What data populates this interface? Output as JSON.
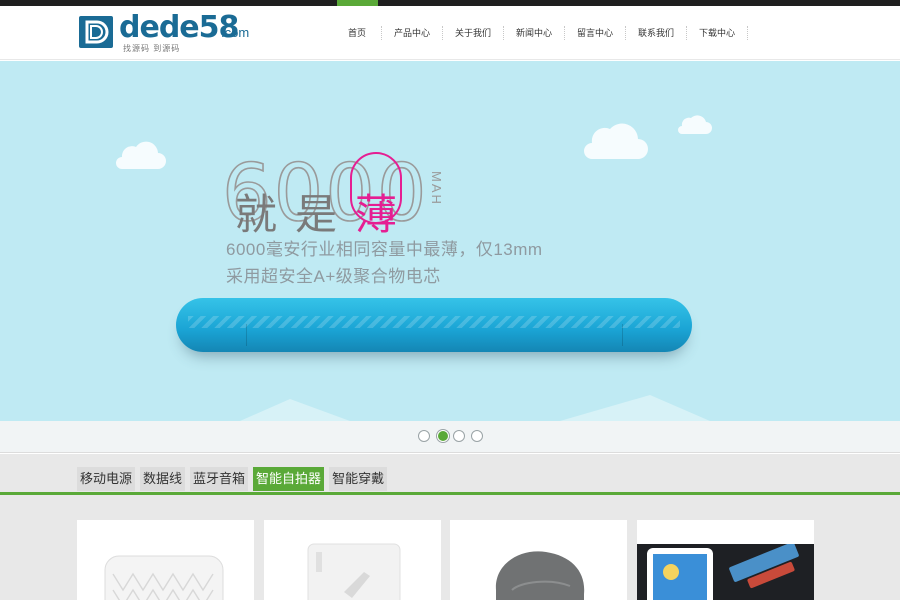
{
  "header": {
    "logo": {
      "brand": "dede58",
      "domain": ".com",
      "slogan": "找源码 到源码"
    },
    "nav": [
      {
        "label": "首页"
      },
      {
        "label": "产品中心"
      },
      {
        "label": "关于我们"
      },
      {
        "label": "新闻中心"
      },
      {
        "label": "留言中心"
      },
      {
        "label": "联系我们"
      },
      {
        "label": "下载中心"
      }
    ]
  },
  "banner": {
    "big_number": "6000",
    "headline_chars": [
      "就",
      "是",
      "薄"
    ],
    "unit": "MAH",
    "tagline_1": "6000毫安行业相同容量中最薄，仅13mm",
    "tagline_2": "采用超安全A+级聚合物电芯",
    "slide_count": 4,
    "active_slide": 2
  },
  "products": {
    "tabs": [
      {
        "label": "移动电源",
        "active": false
      },
      {
        "label": "数据线",
        "active": false
      },
      {
        "label": "蓝牙音箱",
        "active": false
      },
      {
        "label": "智能自拍器",
        "active": true
      },
      {
        "label": "智能穿戴",
        "active": false
      }
    ],
    "card_count": 4
  },
  "colors": {
    "accent_green": "#5aa938",
    "banner_bg": "#bfeaf3",
    "brand_blue": "#1a6b95",
    "highlight_pink": "#e51e92",
    "powerbank_blue": "#1aa3d4"
  },
  "icons": [
    "cloud-icon",
    "slide-dot-icon"
  ]
}
